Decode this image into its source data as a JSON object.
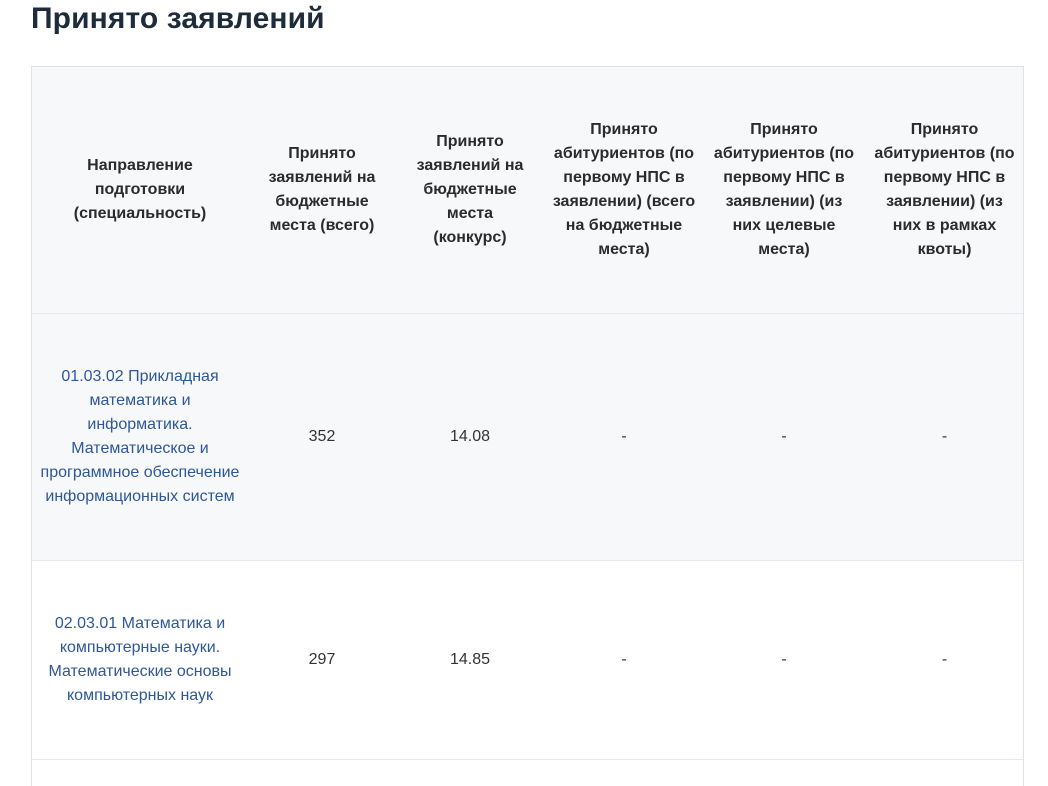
{
  "page": {
    "title": "Принято заявлений"
  },
  "table": {
    "headers": [
      "Направление подготовки (специальность)",
      "Принято заявлений на бюджетные места (всего)",
      "Принято заявлений на бюджетные места (конкурс)",
      "Принято абитуриентов (по первому НПС в заявлении) (всего на бюджетные места)",
      "Принято абитуриентов (по первому НПС в заявлении) (из них целевые места)",
      "Принято абитуриентов (по первому НПС в заявлении) (из них в рамках квоты)"
    ],
    "rows": [
      {
        "program": "01.03.02 Прикладная математика и информатика. Математическое и программное обеспечение информационных систем",
        "total": "352",
        "competition": "14.08",
        "accepted_total": "-",
        "accepted_targeted": "-",
        "accepted_quota": "-"
      },
      {
        "program": "02.03.01 Математика и компьютерные науки. Математические основы компьютерных наук",
        "total": "297",
        "competition": "14.85",
        "accepted_total": "-",
        "accepted_targeted": "-",
        "accepted_quota": "-"
      }
    ]
  },
  "colors": {
    "link": "#2d5796",
    "header_bg": "#f7f8fa",
    "border": "#dfe3e8"
  }
}
